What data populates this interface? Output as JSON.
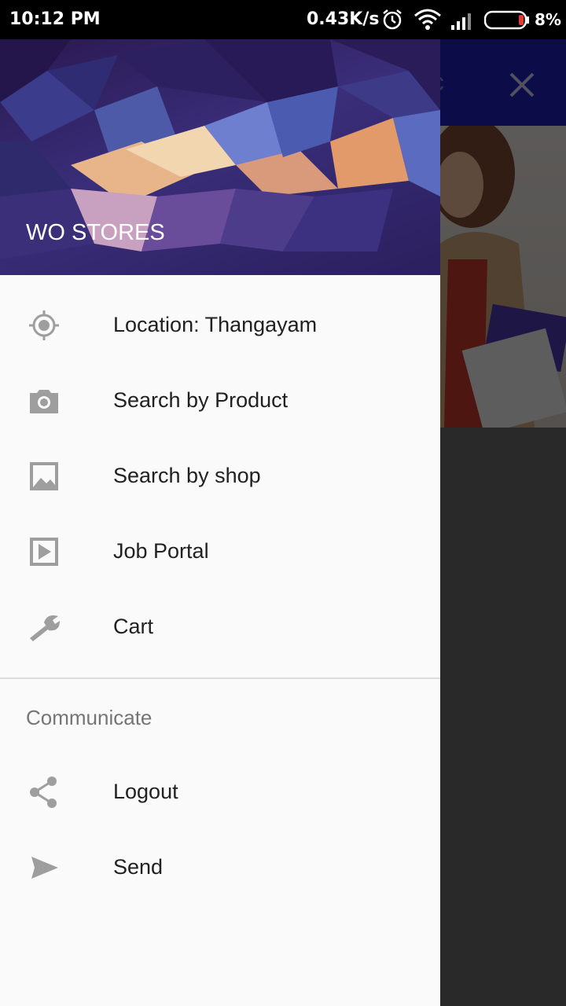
{
  "status_bar": {
    "time": "10:12 PM",
    "network_speed": "0.43K/s",
    "battery_percent": "8%",
    "icons": [
      "alarm-icon",
      "wifi-icon",
      "signal-icon",
      "battery-icon"
    ]
  },
  "background": {
    "toolbar_partial_text": "tc",
    "close_icon": "close-icon",
    "toolbar_color": "#1e1eb4"
  },
  "drawer": {
    "header_title": "WO STORES",
    "items": [
      {
        "label": "Location: Thangayam",
        "icon": "location-crosshair-icon"
      },
      {
        "label": "Search by Product",
        "icon": "camera-icon"
      },
      {
        "label": "Search by shop",
        "icon": "image-icon"
      },
      {
        "label": "Job Portal",
        "icon": "play-box-icon"
      },
      {
        "label": "Cart",
        "icon": "wrench-icon"
      }
    ],
    "section_title": "Communicate",
    "section_items": [
      {
        "label": "Logout",
        "icon": "share-icon"
      },
      {
        "label": "Send",
        "icon": "send-icon"
      }
    ],
    "icon_color": "#9e9e9e"
  }
}
